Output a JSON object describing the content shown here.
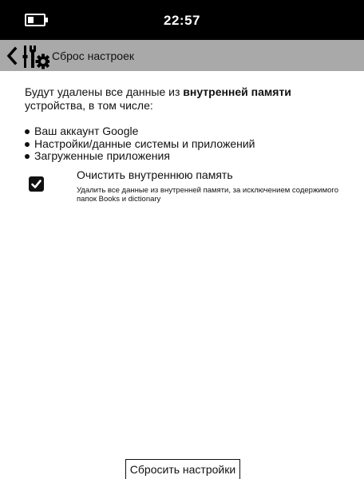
{
  "status_bar": {
    "time": "22:57"
  },
  "header": {
    "title": "Сброс настроек"
  },
  "content": {
    "intro_before": "Будут удалены все данные из ",
    "intro_bold": "внутренней памяти",
    "intro_after": " устройства, в том числе:",
    "items": [
      "Ваш аккаунт Google",
      "Настройки/данные системы и приложений",
      "Загруженные приложения"
    ]
  },
  "option": {
    "checked": true,
    "title": "Очистить внутреннюю память",
    "description": "Удалить все данные из внутренней памяти, за исключением содержимого папок Books и dictionary"
  },
  "reset_button": {
    "label": "Сбросить настройки"
  }
}
